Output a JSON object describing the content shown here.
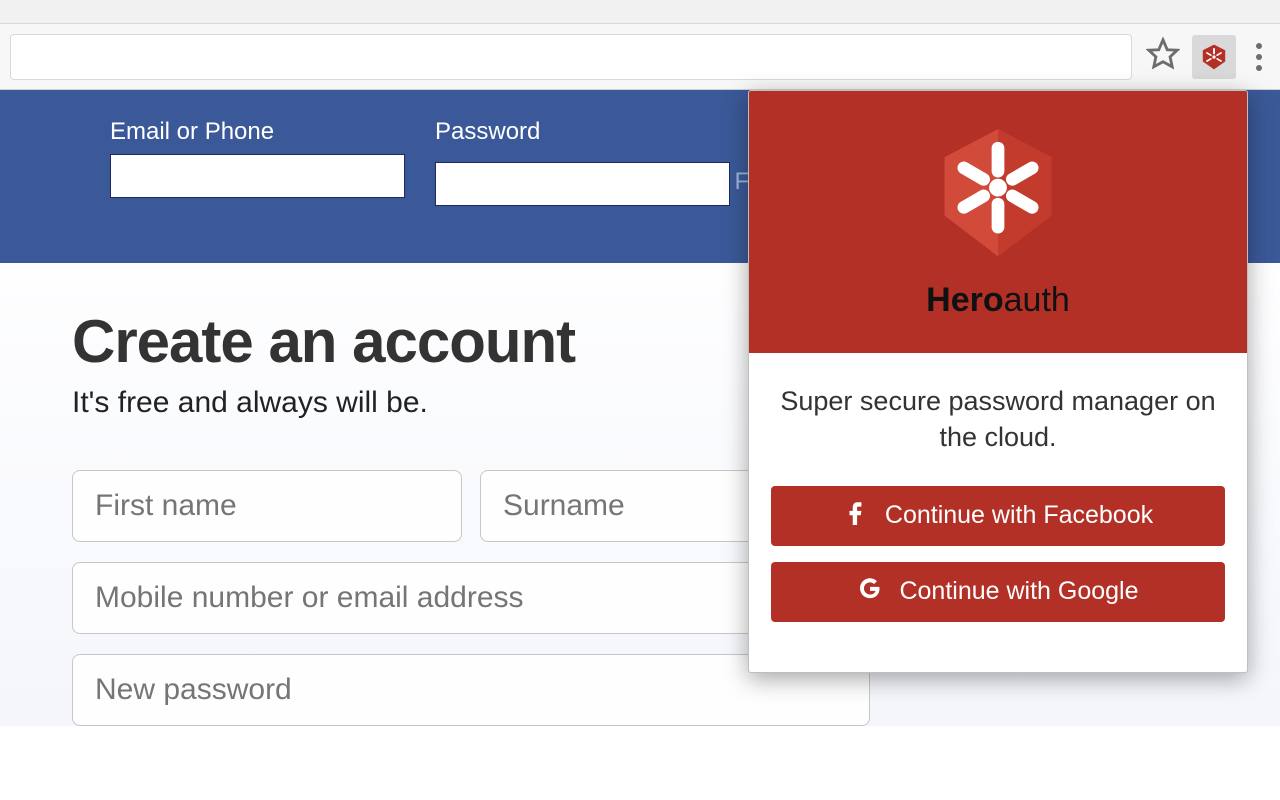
{
  "browser": {
    "star_icon": "star-icon",
    "extension_icon": "heroauth-extension-icon",
    "menu_icon": "kebab-menu-icon"
  },
  "fb": {
    "login": {
      "email_label": "Email or Phone",
      "password_label": "Password",
      "forgot": "Forgotten account?"
    },
    "signup": {
      "heading": "Create an account",
      "subheading": "It's free and always will be.",
      "first_name_placeholder": "First name",
      "surname_placeholder": "Surname",
      "contact_placeholder": "Mobile number or email address",
      "password_placeholder": "New password"
    }
  },
  "popup": {
    "brand_bold": "Hero",
    "brand_thin": "auth",
    "tagline": "Super secure password manager on the cloud.",
    "cta_facebook": "Continue with Facebook",
    "cta_google": "Continue with Google"
  }
}
